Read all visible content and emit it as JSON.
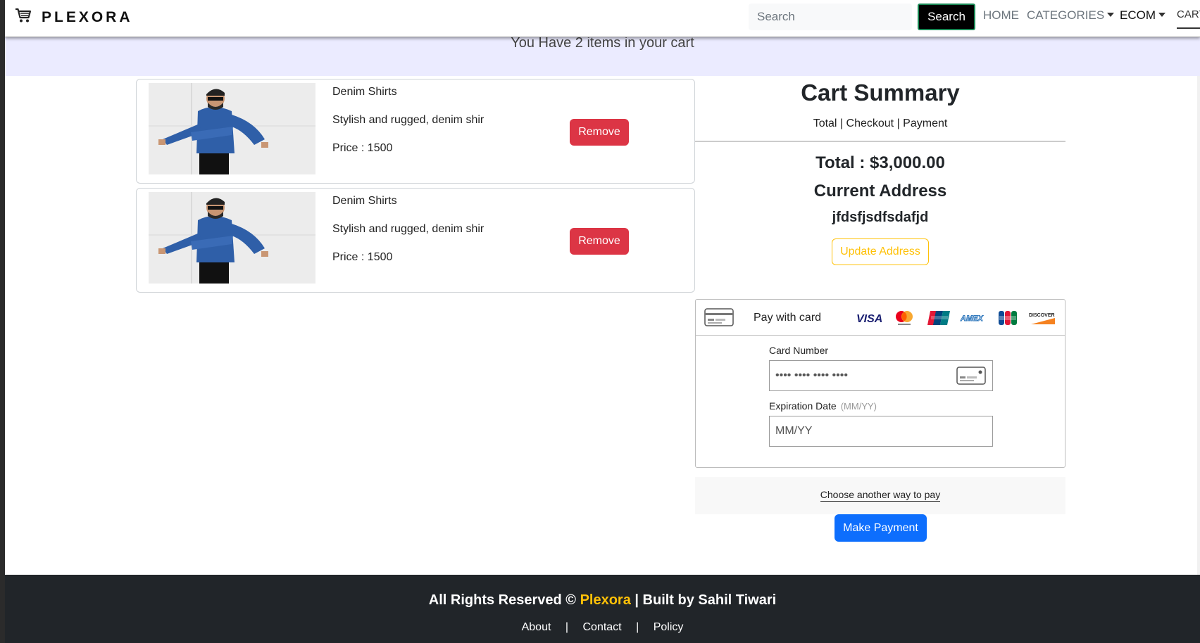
{
  "navbar": {
    "brand": "PLEXORA",
    "search_placeholder": "Search",
    "search_button": "Search",
    "links": {
      "home": "HOME",
      "categories": "CATEGORIES",
      "ecom": "ECOM",
      "cart": "CART"
    }
  },
  "banner": {
    "text": "You Have 2 items in your cart"
  },
  "cart_items": [
    {
      "title": "Denim Shirts",
      "description": "Stylish and rugged, denim shir",
      "price_label": "Price : ",
      "price": "1500",
      "remove_label": "Remove"
    },
    {
      "title": "Denim Shirts",
      "description": "Stylish and rugged, denim shir",
      "price_label": "Price : ",
      "price": "1500",
      "remove_label": "Remove"
    }
  ],
  "summary": {
    "title": "Cart Summary",
    "subtitle": "Total | Checkout | Payment",
    "total": "Total : $3,000.00",
    "address_label": "Current Address",
    "address_value": "jfdsfjsdfsdafjd",
    "update_address": "Update Address"
  },
  "payment": {
    "pay_with_card": "Pay with card",
    "card_brands": [
      "VISA",
      "mastercard",
      "UnionPay",
      "AMEX",
      "JCB",
      "DISCOVER"
    ],
    "card_number_label": "Card Number",
    "card_number_placeholder": "•••• •••• •••• ••••",
    "expiration_label": "Expiration Date",
    "expiration_hint": "(MM/YY)",
    "expiration_placeholder": "MM/YY",
    "alt_pay": "Choose another way to pay",
    "make_payment": "Make Payment"
  },
  "footer": {
    "rights_prefix": "All Rights Reserved © ",
    "brand": "Plexora",
    "built_by": " | Built by Sahil Tiwari",
    "links": [
      "About",
      "Contact",
      "Policy"
    ],
    "separator": "|"
  },
  "colors": {
    "remove": "#dc3545",
    "update": "#ffc107",
    "primary": "#0d6efd",
    "footer_bg": "#212529",
    "banner_bg": "#ebebff"
  }
}
